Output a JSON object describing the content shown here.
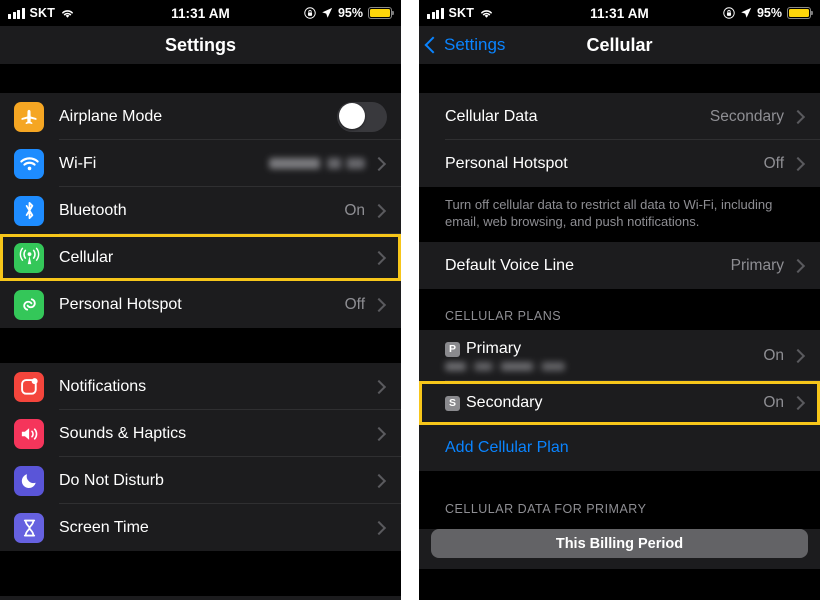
{
  "status_bar": {
    "carrier": "SKT",
    "time": "11:31 AM",
    "battery_pct": "95%",
    "icons": [
      "signal-bars-icon",
      "wifi-icon",
      "rotation-lock-icon",
      "location-arrow-icon",
      "battery-icon"
    ]
  },
  "left_screen": {
    "nav": {
      "title": "Settings"
    },
    "group1": [
      {
        "label": "Airplane Mode",
        "icon": "airplane-icon",
        "icon_color": "#F5A623",
        "control": "toggle",
        "toggle_on": false
      },
      {
        "label": "Wi-Fi",
        "icon": "wifi-icon",
        "icon_color": "#1E8CFF",
        "value": "",
        "value_blurred": true
      },
      {
        "label": "Bluetooth",
        "icon": "bluetooth-icon",
        "icon_color": "#1E8CFF",
        "value": "On"
      },
      {
        "label": "Cellular",
        "icon": "cellular-antenna-icon",
        "icon_color": "#34C759",
        "value": "",
        "highlighted": true
      },
      {
        "label": "Personal Hotspot",
        "icon": "personal-hotspot-icon",
        "icon_color": "#34C759",
        "value": "Off"
      }
    ],
    "group2": [
      {
        "label": "Notifications",
        "icon": "notifications-icon",
        "icon_color": "#F4453C",
        "value": ""
      },
      {
        "label": "Sounds & Haptics",
        "icon": "sounds-haptics-icon",
        "icon_color": "#F5355B",
        "value": ""
      },
      {
        "label": "Do Not Disturb",
        "icon": "do-not-disturb-moon-icon",
        "icon_color": "#5A55D8",
        "value": ""
      },
      {
        "label": "Screen Time",
        "icon": "screen-time-hourglass-icon",
        "icon_color": "#6661E0",
        "value": ""
      }
    ]
  },
  "right_screen": {
    "nav": {
      "back_label": "Settings",
      "title": "Cellular"
    },
    "group1": [
      {
        "label": "Cellular Data",
        "value": "Secondary"
      },
      {
        "label": "Personal Hotspot",
        "value": "Off"
      }
    ],
    "footnote1": "Turn off cellular data to restrict all data to Wi-Fi, including email, web browsing, and push notifications.",
    "group2": [
      {
        "label": "Default Voice Line",
        "value": "Primary"
      }
    ],
    "plans_header": "CELLULAR PLANS",
    "plans": [
      {
        "badge": "P",
        "label": "Primary",
        "value": "On",
        "subtitle_blurred": true,
        "highlighted": false
      },
      {
        "badge": "S",
        "label": "Secondary",
        "value": "On",
        "subtitle_blurred": false,
        "highlighted": true
      }
    ],
    "add_plan_label": "Add Cellular Plan",
    "data_header": "CELLULAR DATA FOR PRIMARY",
    "segment_label": "This Billing Period"
  },
  "theme": {
    "highlight_color": "#F7C61A",
    "accent_blue": "#0A84FF",
    "battery_yellow": "#FFD60A"
  }
}
